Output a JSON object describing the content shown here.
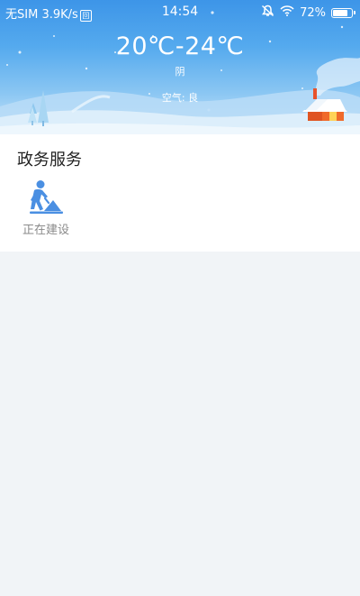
{
  "status_bar": {
    "carrier": "无SIM",
    "speed": "3.9K/s",
    "sim_badge": "回",
    "time": "14:54",
    "battery_percent": "72%",
    "battery_level": 0.72
  },
  "weather": {
    "temperature_range": "20℃-24℃",
    "condition": "阴",
    "air_quality": "空气: 良"
  },
  "section": {
    "title": "政务服务",
    "items": [
      {
        "label": "正在建设",
        "icon": "construction-worker-icon"
      }
    ]
  },
  "colors": {
    "header_top": "#3d95e8",
    "header_bottom": "#cfe8fa",
    "icon_blue": "#4a8fe2",
    "page_background": "#f1f4f7"
  }
}
